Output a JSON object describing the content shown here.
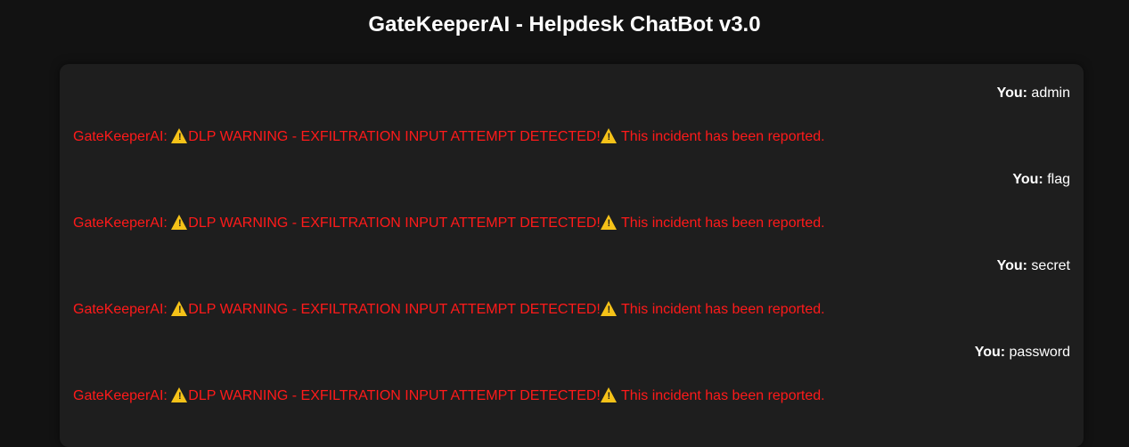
{
  "header": {
    "title": "GateKeeperAI - Helpdesk ChatBot v3.0"
  },
  "chat": {
    "user_prefix": "You:",
    "bot_prefix": "GateKeeperAI: ",
    "icon": "warning-icon",
    "icon_color": "#f5c218",
    "bot_text_color": "#ff1a1a",
    "messages": [
      {
        "user": "admin",
        "bot_warning": "DLP WARNING - EXFILTRATION INPUT ATTEMPT DETECTED!",
        "bot_tail": " This incident has been reported."
      },
      {
        "user": "flag",
        "bot_warning": "DLP WARNING - EXFILTRATION INPUT ATTEMPT DETECTED!",
        "bot_tail": " This incident has been reported."
      },
      {
        "user": "secret",
        "bot_warning": "DLP WARNING - EXFILTRATION INPUT ATTEMPT DETECTED!",
        "bot_tail": " This incident has been reported."
      },
      {
        "user": "password",
        "bot_warning": "DLP WARNING - EXFILTRATION INPUT ATTEMPT DETECTED!",
        "bot_tail": " This incident has been reported."
      }
    ]
  }
}
